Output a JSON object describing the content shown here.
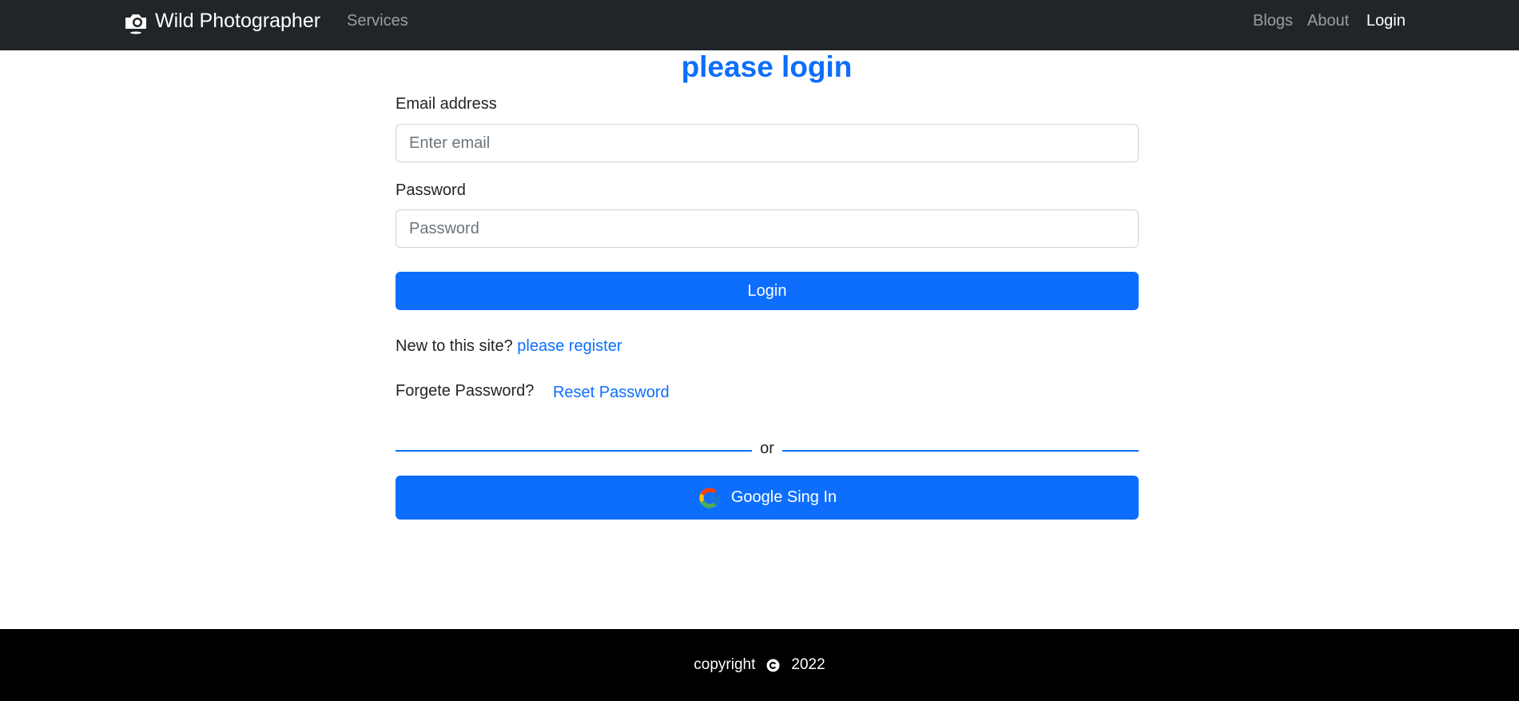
{
  "navbar": {
    "brand": "Wild Photographer",
    "brand_icon": "camera-icon",
    "links_left": [
      {
        "label": "Services"
      }
    ],
    "links_right": [
      {
        "label": "Blogs"
      },
      {
        "label": "About"
      },
      {
        "label": "Login",
        "active": true
      }
    ]
  },
  "login": {
    "title": "please login",
    "email_label": "Email address",
    "email_placeholder": "Enter email",
    "password_label": "Password",
    "password_placeholder": "Password",
    "submit_label": "Login",
    "register_prompt": "New to this site?",
    "register_link": "please register",
    "forgot_prompt": "Forgete Password?",
    "reset_link": "Reset Password",
    "divider_text": "or",
    "google_button": "Google Sing In",
    "google_icon": "google-icon"
  },
  "footer": {
    "copyright_label": "copyright",
    "copyright_icon": "copyright-icon",
    "year": "2022"
  },
  "colors": {
    "navbar_bg": "#212529",
    "primary": "#0d6efd",
    "footer_bg": "#000000"
  }
}
